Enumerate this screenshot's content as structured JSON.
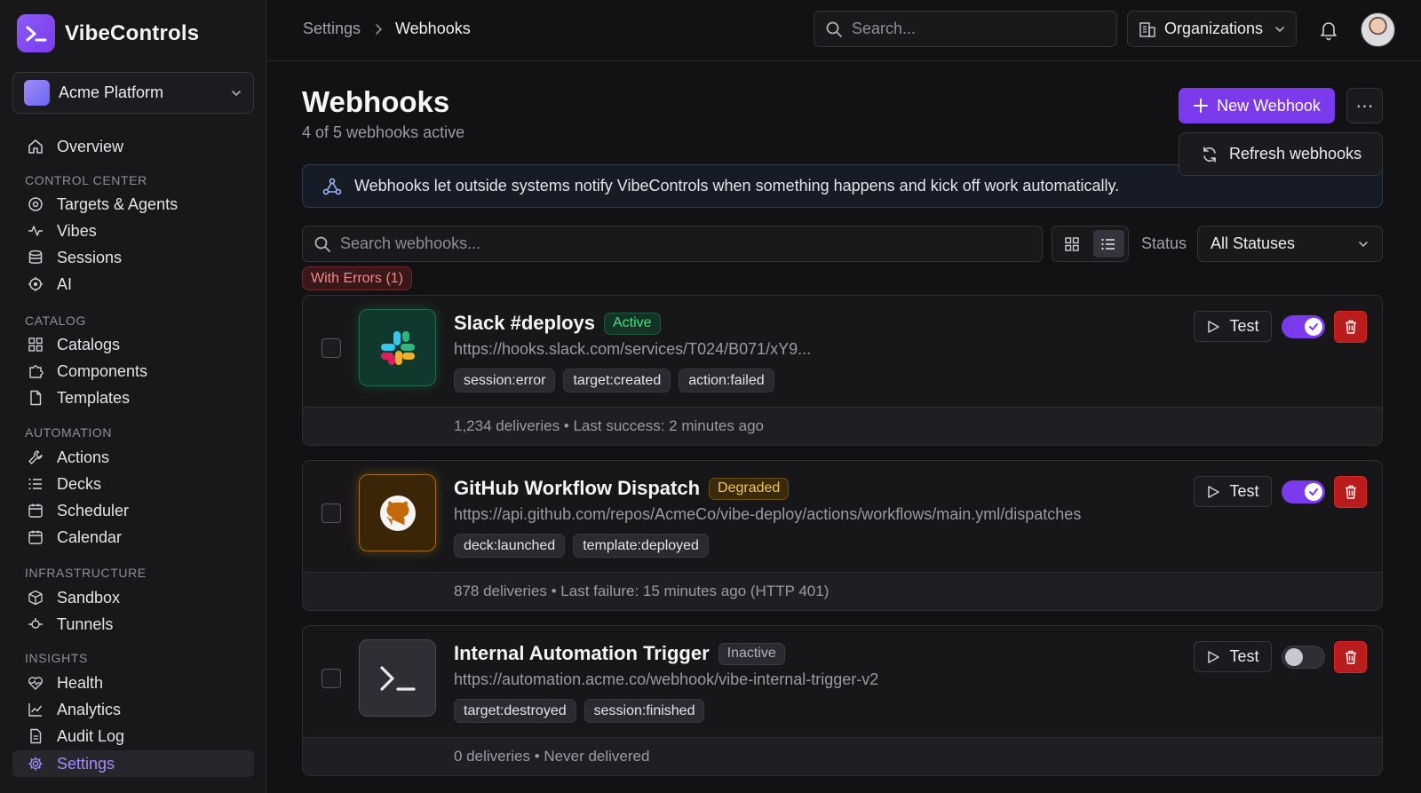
{
  "app": {
    "name": "VibeControls"
  },
  "org_selector": {
    "name": "Acme Platform"
  },
  "sidebar": {
    "overview": "Overview",
    "sections": {
      "control_center": "CONTROL CENTER",
      "catalog": "CATALOG",
      "automation": "AUTOMATION",
      "infrastructure": "INFRASTRUCTURE",
      "insights": "INSIGHTS"
    },
    "items": {
      "targets_agents": "Targets & Agents",
      "vibes": "Vibes",
      "sessions": "Sessions",
      "ai": "AI",
      "catalogs": "Catalogs",
      "components": "Components",
      "templates": "Templates",
      "actions": "Actions",
      "decks": "Decks",
      "scheduler": "Scheduler",
      "calendar": "Calendar",
      "sandbox": "Sandbox",
      "tunnels": "Tunnels",
      "health": "Health",
      "analytics": "Analytics",
      "audit_log": "Audit Log",
      "settings": "Settings"
    }
  },
  "topbar": {
    "breadcrumb": [
      "Settings",
      "Webhooks"
    ],
    "search_placeholder": "Search...",
    "org_button": "Organizations"
  },
  "page": {
    "title": "Webhooks",
    "subtitle": "4 of 5 webhooks active",
    "new_button": "New Webhook",
    "more_button": "⋯",
    "refresh_menu_item": "Refresh webhooks",
    "info_banner": "Webhooks let outside systems notify VibeControls when something happens and kick off work automatically."
  },
  "filters": {
    "search_placeholder": "Search webhooks...",
    "status_label": "Status",
    "status_value": "All Statuses",
    "errors_chip": "With Errors (1)"
  },
  "webhooks": [
    {
      "name": "Slack #deploys",
      "status": "Active",
      "url": "https://hooks.slack.com/services/T024/B071/xY9...",
      "tags": [
        "session:error",
        "target:created",
        "action:failed"
      ],
      "enabled": true,
      "footer": "1,234 deliveries • Last success: 2 minutes ago",
      "test_label": "Test",
      "icon": "slack-logo"
    },
    {
      "name": "GitHub Workflow Dispatch",
      "status": "Degraded",
      "url": "https://api.github.com/repos/AcmeCo/vibe-deploy/actions/workflows/main.yml/dispatches",
      "tags": [
        "deck:launched",
        "template:deployed"
      ],
      "enabled": true,
      "footer": "878 deliveries • Last failure: 15 minutes ago (HTTP 401)",
      "test_label": "Test",
      "icon": "github-logo"
    },
    {
      "name": "Internal Automation Trigger",
      "status": "Inactive",
      "url": "https://automation.acme.co/webhook/vibe-internal-trigger-v2",
      "tags": [
        "target:destroyed",
        "session:finished"
      ],
      "enabled": false,
      "footer": "0 deliveries • Never delivered",
      "test_label": "Test",
      "icon": "terminal-icon"
    }
  ],
  "colors": {
    "accent": "#7c3aed",
    "active": "#4ade80",
    "degraded": "#f5c25a",
    "danger": "#b91c1c"
  }
}
